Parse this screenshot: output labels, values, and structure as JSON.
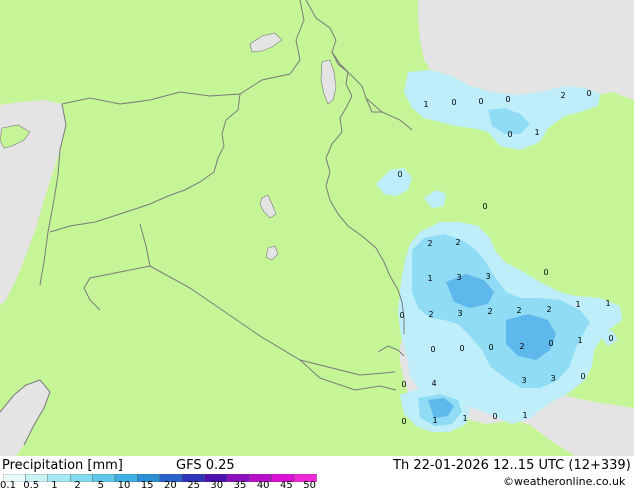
{
  "title": "Precipitation [mm]",
  "model": "GFS 0.25",
  "valid_time": "Th 22-01-2026 12..15 UTC (12+339)",
  "credit": "©weatheronline.co.uk",
  "legend_ticks": [
    "0.1",
    "0.5",
    "1",
    "2",
    "5",
    "10",
    "15",
    "20",
    "25",
    "30",
    "35",
    "40",
    "45",
    "50"
  ],
  "legend_colors": [
    "#e9fbfb",
    "#c7f3f7",
    "#a5e9f3",
    "#83dcef",
    "#5fc8ea",
    "#3eaee3",
    "#2a8fd6",
    "#2a62c8",
    "#2c35b8",
    "#4b10b0",
    "#8a0fbe",
    "#b80fca",
    "#db10d4",
    "#f028d8"
  ],
  "map_colors": {
    "land": "#c6f597",
    "sea": "#e4e4e4",
    "rain_light": "#bdeefa",
    "rain_med": "#90dcf5",
    "rain_heavy": "#5fb8ec",
    "borders": "#7a7a7a"
  },
  "map_values": [
    "1",
    "0",
    "0",
    "0",
    "2",
    "0",
    "0",
    "1",
    "0",
    "0",
    "2",
    "2",
    "1",
    "3",
    "3",
    "0",
    "2",
    "3",
    "2",
    "2",
    "2",
    "1",
    "1",
    "0",
    "0",
    "0",
    "0",
    "2",
    "0",
    "1",
    "3",
    "3",
    "0",
    "0",
    "0",
    "4",
    "1",
    "1",
    "0",
    "1",
    "0"
  ]
}
